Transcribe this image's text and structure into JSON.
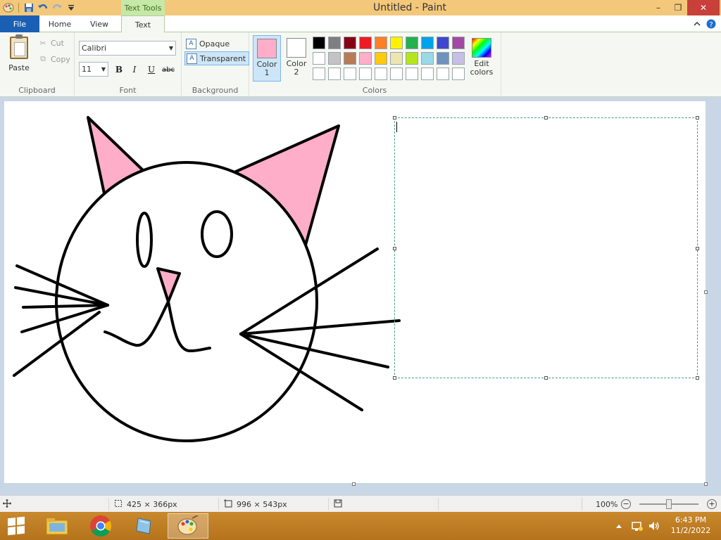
{
  "window": {
    "title": "Untitled - Paint",
    "context_tab": "Text Tools",
    "minimize_glyph": "–",
    "maximize_glyph": "❐",
    "close_glyph": "✕"
  },
  "tabs": {
    "file": "File",
    "home": "Home",
    "view": "View",
    "text": "Text"
  },
  "clipboard": {
    "paste": "Paste",
    "cut": "Cut",
    "copy": "Copy",
    "group_label": "Clipboard"
  },
  "font": {
    "name": "Calibri",
    "size": "11",
    "bold": "B",
    "italic": "I",
    "underline": "U",
    "strikethrough": "abc",
    "group_label": "Font"
  },
  "background": {
    "opaque": "Opaque",
    "transparent": "Transparent",
    "group_label": "Background"
  },
  "colors": {
    "color1_label": "Color\n1",
    "color2_label": "Color\n2",
    "color1": "#ffaec9",
    "color2": "#ffffff",
    "edit_colors_label": "Edit\ncolors",
    "group_label": "Colors",
    "palette": [
      "#000000",
      "#7f7f7f",
      "#880015",
      "#ed1c24",
      "#ff7f27",
      "#fff200",
      "#22b14c",
      "#00a2e8",
      "#3f48cc",
      "#a349a4",
      "#ffffff",
      "#c3c3c3",
      "#b97a57",
      "#ffaec9",
      "#ffc90e",
      "#efe4b0",
      "#b5e61d",
      "#99d9ea",
      "#7092be",
      "#c8bfe7",
      "#ffffff",
      "#ffffff",
      "#ffffff",
      "#ffffff",
      "#ffffff",
      "#ffffff",
      "#ffffff",
      "#ffffff",
      "#ffffff",
      "#ffffff"
    ]
  },
  "drawing": {
    "stroke": "#000000",
    "ear_fill": "#ffaec9"
  },
  "status": {
    "selection_size": "425 × 366px",
    "canvas_size": "996 × 543px",
    "zoom": "100%"
  },
  "taskbar": {
    "time": "6:43 PM",
    "date": "11/2/2022"
  }
}
